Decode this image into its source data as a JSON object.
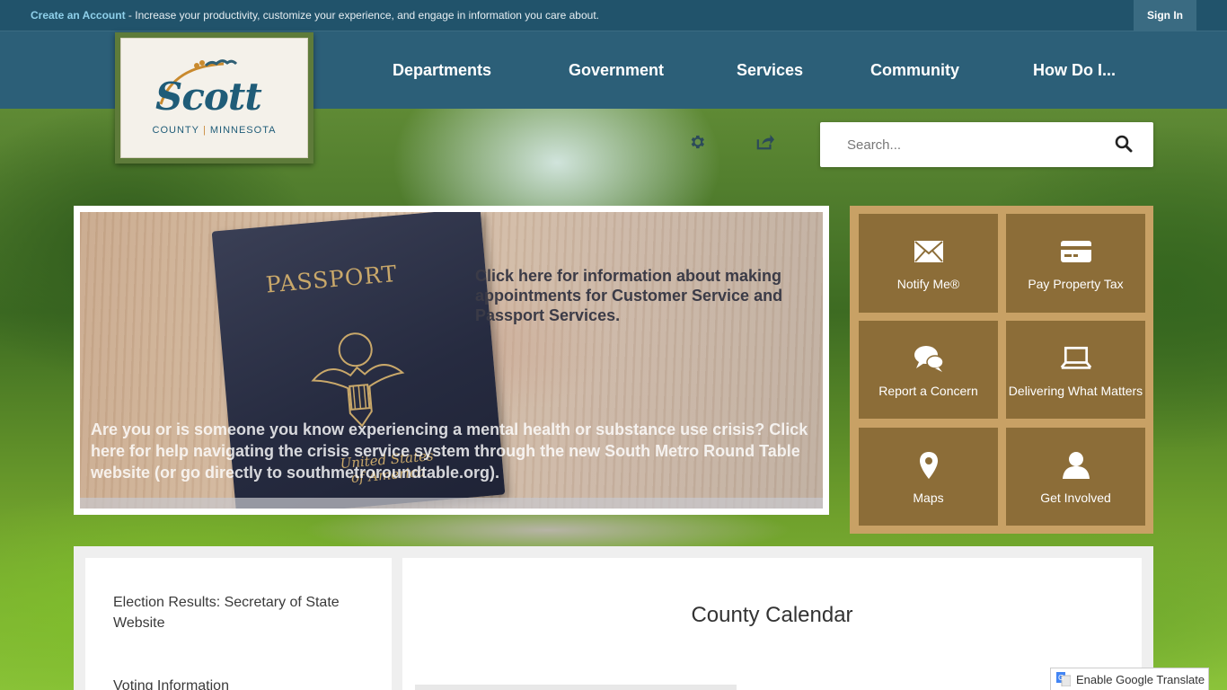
{
  "topbar": {
    "create_account": "Create an Account",
    "message": " - Increase your productivity, customize your experience, and engage in information you care about.",
    "sign_in": "Sign In"
  },
  "logo": {
    "word": "Scott",
    "sub_left": "COUNTY",
    "sub_sep": "|",
    "sub_right": "MINNESOTA"
  },
  "nav": {
    "items": [
      {
        "label": "Departments"
      },
      {
        "label": "Government"
      },
      {
        "label": "Services"
      },
      {
        "label": "Community"
      },
      {
        "label": "How Do I..."
      }
    ]
  },
  "utilities": {
    "settings_icon": "gear-icon",
    "share_icon": "share-icon"
  },
  "search": {
    "placeholder": "Search...",
    "icon": "search-icon"
  },
  "banner": {
    "passport_title": "PASSPORT",
    "passport_country": "United States\nof America",
    "text_top": "Click here for information about making appointments for Customer Service and Passport Services.",
    "text_bottom": "Are you or is someone you know experiencing a mental health or substance use crisis?  Click here for help navigating the crisis service system through the new South Metro Round Table website (or go directly to southmetroroundtable.org)."
  },
  "quick_links": [
    {
      "label": "Notify Me®",
      "icon": "envelope-icon"
    },
    {
      "label": "Pay Property Tax",
      "icon": "credit-card-icon"
    },
    {
      "label": "Report a Concern",
      "icon": "chat-bubbles-icon"
    },
    {
      "label": "Delivering What Matters",
      "icon": "laptop-icon"
    },
    {
      "label": "Maps",
      "icon": "map-pin-icon"
    },
    {
      "label": "Get Involved",
      "icon": "person-icon"
    }
  ],
  "sidebar": {
    "links": [
      {
        "label": "Election Results: Secretary of State Website"
      },
      {
        "label": "Voting Information"
      }
    ]
  },
  "main": {
    "title": "County Calendar"
  },
  "translate": {
    "label": "Enable Google Translate"
  },
  "colors": {
    "topbar": "#21536b",
    "navbar": "#2c5f78",
    "quick_bg": "#c8a165",
    "tile": "#8c6d38"
  }
}
